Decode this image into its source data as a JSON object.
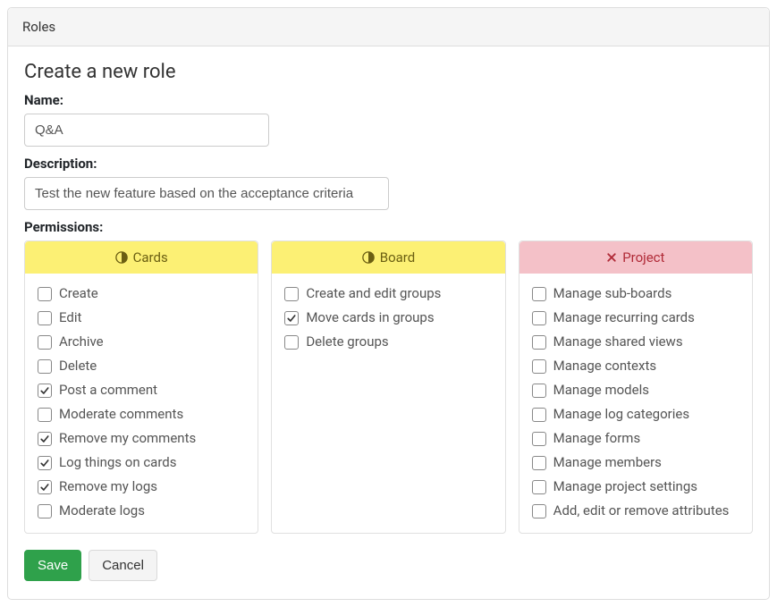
{
  "header": {
    "title": "Roles"
  },
  "form": {
    "title": "Create a new role",
    "name_label": "Name:",
    "name_value": "Q&A",
    "desc_label": "Description:",
    "desc_value": "Test the new feature based on the acceptance criteria",
    "perms_label": "Permissions:",
    "save_label": "Save",
    "cancel_label": "Cancel"
  },
  "perm_columns": [
    {
      "id": "cards",
      "title": "Cards",
      "header_style": "yellow",
      "icon": "adjust",
      "items": [
        {
          "label": "Create",
          "checked": false
        },
        {
          "label": "Edit",
          "checked": false
        },
        {
          "label": "Archive",
          "checked": false
        },
        {
          "label": "Delete",
          "checked": false
        },
        {
          "label": "Post a comment",
          "checked": true
        },
        {
          "label": "Moderate comments",
          "checked": false
        },
        {
          "label": "Remove my comments",
          "checked": true
        },
        {
          "label": "Log things on cards",
          "checked": true
        },
        {
          "label": "Remove my logs",
          "checked": true
        },
        {
          "label": "Moderate logs",
          "checked": false
        }
      ]
    },
    {
      "id": "board",
      "title": "Board",
      "header_style": "yellow",
      "icon": "adjust",
      "items": [
        {
          "label": "Create and edit groups",
          "checked": false
        },
        {
          "label": "Move cards in groups",
          "checked": true
        },
        {
          "label": "Delete groups",
          "checked": false
        }
      ]
    },
    {
      "id": "project",
      "title": "Project",
      "header_style": "red",
      "icon": "close",
      "items": [
        {
          "label": "Manage sub-boards",
          "checked": false
        },
        {
          "label": "Manage recurring cards",
          "checked": false
        },
        {
          "label": "Manage shared views",
          "checked": false
        },
        {
          "label": "Manage contexts",
          "checked": false
        },
        {
          "label": "Manage models",
          "checked": false
        },
        {
          "label": "Manage log categories",
          "checked": false
        },
        {
          "label": "Manage forms",
          "checked": false
        },
        {
          "label": "Manage members",
          "checked": false
        },
        {
          "label": "Manage project settings",
          "checked": false
        },
        {
          "label": "Add, edit or remove attributes",
          "checked": false
        }
      ]
    }
  ]
}
